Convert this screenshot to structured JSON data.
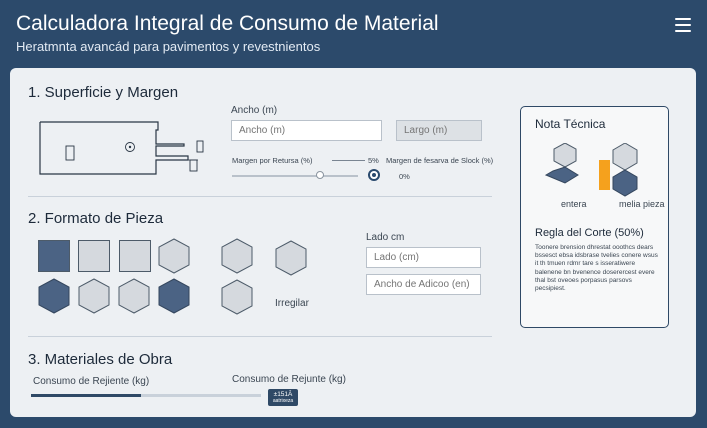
{
  "header": {
    "title": "Calculadora Integral de Consumo de Material",
    "subtitle": "Heratmnta avancád para pavimentos y revestnientos"
  },
  "section1": {
    "title": "1. Superficie y Margen",
    "ancho_label": "Ancho (m)",
    "ancho_placeholder": "Ancho (m)",
    "largo_placeholder": "Largo (m)",
    "margen_label": "Margen por Retursa (%)",
    "margen_value": "5%",
    "reserva_label": "Margen de fesarva de Slock (%)",
    "reserva_value": "0%",
    "margen_fraction": 0.7
  },
  "section2": {
    "title": "2. Formato de Pieza",
    "irregular_label": "Irregilar",
    "lado_label": "Lado cm",
    "lado_placeholder": "Lado (cm)",
    "ancho_adoquin_placeholder": "Ancho de Adicoo (en)"
  },
  "section3": {
    "title": "3. Materiales de Obra",
    "rejuntes_label": "Consumo de Rejiente (kg)",
    "rejunte_label": "Consumo de Rejunte (kg)",
    "progress_fraction": 0.48,
    "badge_value": "±151Ā",
    "badge_sub": "aatrixeza"
  },
  "note": {
    "title": "Nota Técnica",
    "entera_label": "entera",
    "media_label": "melia pieza",
    "rule": "Regla del Corte (50%)",
    "body": "Toonere brension dhrestat ooothcs dears bssesct ebsa idsbrase tvelies conere wsus it th tmuen rdmr tare s isseratiwere balenene bn bvenence doserercest evere thal bst oveoes porpasus parsovs pecsipiest."
  },
  "colors": {
    "background": "#2c4a6b",
    "card": "#edf0f3",
    "accent": "#2f4966",
    "tile_dark": "#4b6384",
    "tile_light": "#d5d9de",
    "highlight": "#f5a11d"
  }
}
